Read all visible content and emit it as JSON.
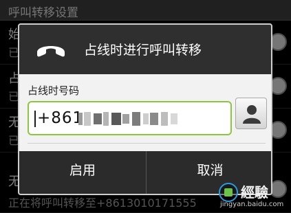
{
  "background": {
    "header_title": "呼叫转移设置",
    "rows": [
      {
        "title": "始",
        "subtitle": "已"
      },
      {
        "title": "占",
        "subtitle": "已"
      },
      {
        "title": "无",
        "subtitle": "已"
      },
      {
        "title": "无",
        "subtitle": "正在将呼叫转移至+8613010171555"
      }
    ]
  },
  "dialog": {
    "title": "占线时进行呼叫转移",
    "field_label": "占线时号码",
    "number_value": "+861",
    "enable_label": "启用",
    "cancel_label": "取消"
  },
  "watermark": {
    "brand": "經驗",
    "url": "jingyan.baidu.com"
  },
  "icons": {
    "title_icon": "phone-handset-icon",
    "contact_icon": "contact-person-icon"
  },
  "colors": {
    "input_border": "#8cc63f",
    "title_bar": "#2f2f2f",
    "button_bar": "#2b2b2b"
  }
}
